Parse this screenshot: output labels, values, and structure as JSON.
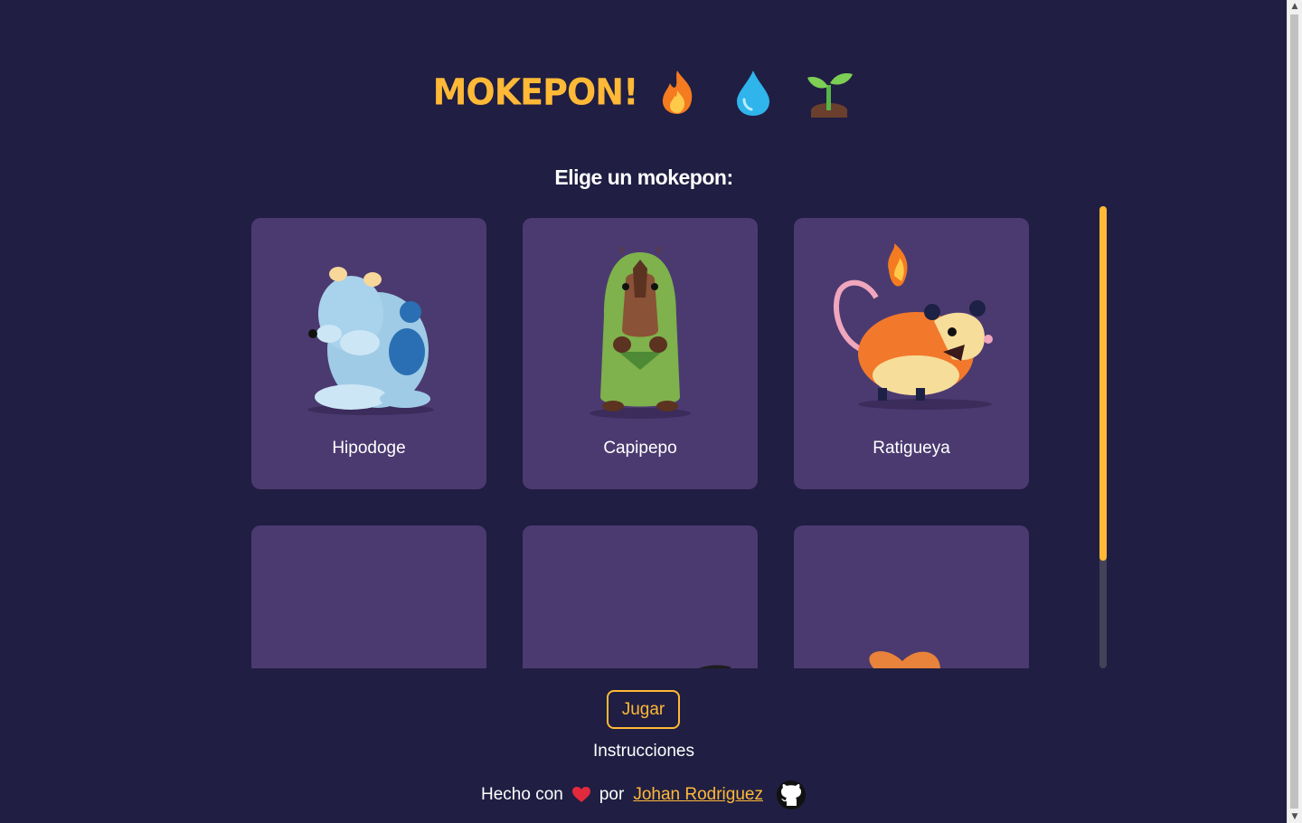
{
  "header": {
    "logo_text": "MOKEPON!",
    "icons": [
      "fire-icon",
      "water-drop-icon",
      "sprout-icon"
    ]
  },
  "subtitle": "Elige un mokepon:",
  "mokepones": [
    {
      "name": "Hipodoge"
    },
    {
      "name": "Capipepo"
    },
    {
      "name": "Ratigueya"
    },
    {
      "name": ""
    },
    {
      "name": ""
    },
    {
      "name": ""
    }
  ],
  "actions": {
    "play_label": "Jugar",
    "instructions_label": "Instrucciones"
  },
  "footer": {
    "made_with": "Hecho con",
    "by": "por",
    "author": "Johan Rodriguez"
  },
  "colors": {
    "background": "#201e42",
    "card": "#4b3a70",
    "accent": "#ffb937"
  }
}
